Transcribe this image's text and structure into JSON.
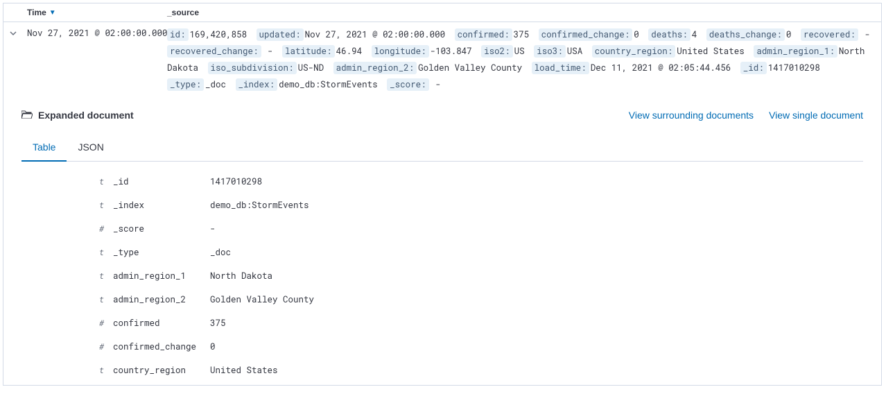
{
  "columns": {
    "time": "Time",
    "source": "_source"
  },
  "row": {
    "time": "Nov 27, 2021 @ 02:00:00.000",
    "source": [
      {
        "k": "id:",
        "v": "169,420,858"
      },
      {
        "k": "updated:",
        "v": "Nov 27, 2021 @ 02:00:00.000"
      },
      {
        "k": "confirmed:",
        "v": "375"
      },
      {
        "k": "confirmed_change:",
        "v": "0"
      },
      {
        "k": "deaths:",
        "v": "4"
      },
      {
        "k": "deaths_change:",
        "v": "0"
      },
      {
        "k": "recovered:",
        "v": " - "
      },
      {
        "k": "recovered_change:",
        "v": " - "
      },
      {
        "k": "latitude:",
        "v": "46.94"
      },
      {
        "k": "longitude:",
        "v": "-103.847"
      },
      {
        "k": "iso2:",
        "v": "US"
      },
      {
        "k": "iso3:",
        "v": "USA"
      },
      {
        "k": "country_region:",
        "v": "United States"
      },
      {
        "k": "admin_region_1:",
        "v": "North Dakota"
      },
      {
        "k": "iso_subdivision:",
        "v": "US-ND"
      },
      {
        "k": "admin_region_2:",
        "v": "Golden Valley County"
      },
      {
        "k": "load_time:",
        "v": "Dec 11, 2021 @ 02:05:44.456"
      },
      {
        "k": "_id:",
        "v": "1417010298"
      },
      {
        "k": "_type:",
        "v": "_doc"
      },
      {
        "k": "_index:",
        "v": "demo_db:StormEvents"
      },
      {
        "k": "_score:",
        "v": " - "
      }
    ]
  },
  "expanded": {
    "title": "Expanded document",
    "links": {
      "surrounding": "View surrounding documents",
      "single": "View single document"
    },
    "tabs": {
      "table": "Table",
      "json": "JSON"
    },
    "fields": [
      {
        "t": "t",
        "name": "_id",
        "val": "1417010298"
      },
      {
        "t": "t",
        "name": "_index",
        "val": "demo_db:StormEvents"
      },
      {
        "t": "#",
        "name": "_score",
        "val": " - "
      },
      {
        "t": "t",
        "name": "_type",
        "val": "_doc"
      },
      {
        "t": "t",
        "name": "admin_region_1",
        "val": "North Dakota"
      },
      {
        "t": "t",
        "name": "admin_region_2",
        "val": "Golden Valley County"
      },
      {
        "t": "#",
        "name": "confirmed",
        "val": "375"
      },
      {
        "t": "#",
        "name": "confirmed_change",
        "val": "0"
      },
      {
        "t": "t",
        "name": "country_region",
        "val": "United States"
      }
    ]
  }
}
